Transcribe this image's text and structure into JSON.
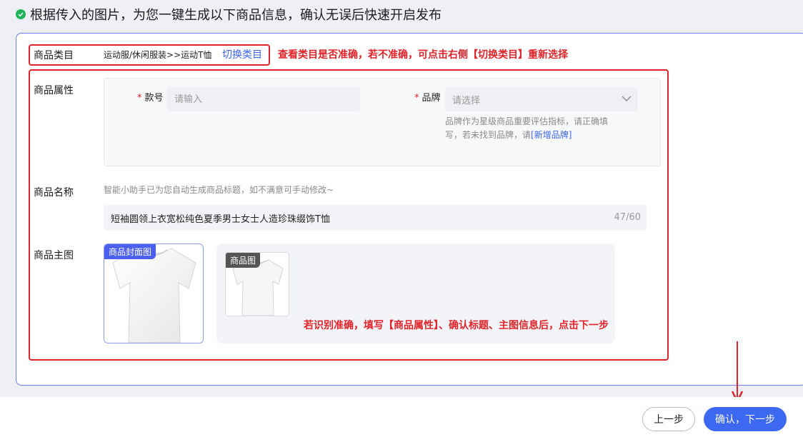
{
  "header": {
    "text": "根据传入的图片，为您一键生成以下商品信息，确认无误后快速开启发布"
  },
  "category": {
    "label": "商品类目",
    "value": "运动服/休闲服装>>运动T恤",
    "switch_link": "切换类目",
    "annotation": "查看类目是否准确，若不准确，可点击右侧【切换类目】重新选择"
  },
  "attributes": {
    "label": "商品属性",
    "style_no": {
      "label": "款号",
      "placeholder": "请输入"
    },
    "brand": {
      "label": "品牌",
      "placeholder": "请选择",
      "hint_line1": "品牌作为星级商品重要评估指标，请正确填",
      "hint_line2": "写，若未找到品牌，请",
      "hint_link": "[新增品牌]"
    }
  },
  "product_name": {
    "label": "商品名称",
    "hint": "智能小助手已为您自动生成商品标题，如不满意可手动修改~",
    "value": "短袖圆领上衣宽松纯色夏季男士女士人造珍珠缀饰T恤",
    "counter": "47/60"
  },
  "main_image": {
    "label": "商品主图",
    "cover_badge": "商品封面图",
    "image_badge": "商品图",
    "annotation": "若识别准确，填写【商品属性】、确认标题、主图信息后，点击下一步"
  },
  "footer": {
    "prev_label": "上一步",
    "next_label": "确认，下一步"
  },
  "colors": {
    "accent": "#3c68f2",
    "annotation_red": "#e0242a",
    "success_green": "#21b35a"
  }
}
